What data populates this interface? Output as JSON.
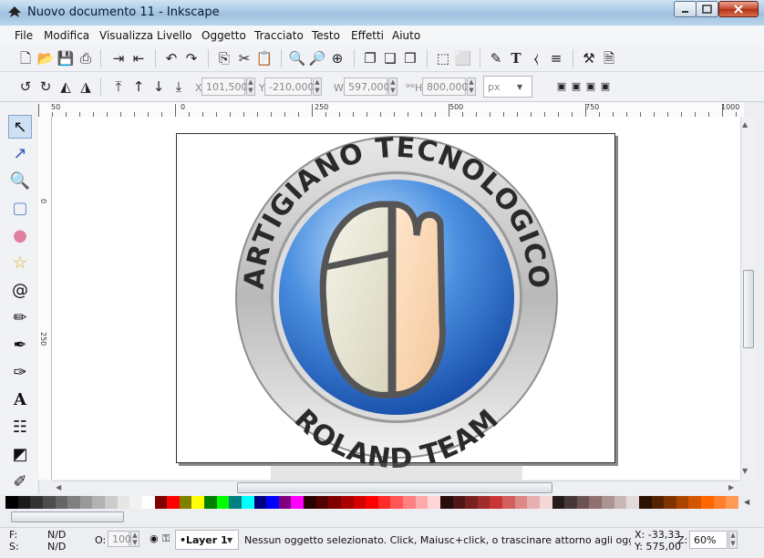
{
  "window": {
    "title": "Nuovo documento 11 - Inkscape",
    "icon": "inkscape-icon"
  },
  "menu": [
    "File",
    "Modifica",
    "Visualizza",
    "Livello",
    "Oggetto",
    "Tracciato",
    "Testo",
    "Effetti",
    "Aiuto"
  ],
  "toolbar2": {
    "x_label": "X",
    "x_value": "101,500",
    "y_label": "Y",
    "y_value": "-210,000",
    "w_label": "W",
    "w_value": "597,000",
    "h_label": "H",
    "h_value": "800,000",
    "unit": "px"
  },
  "ruler_top": [
    "50",
    "0",
    "250",
    "500",
    "750",
    "1000"
  ],
  "ruler_left": [
    "0",
    "250"
  ],
  "artwork": {
    "top_text": "ARTIGIANO TECNOLOGICO",
    "bottom_text": "ROLAND TEAM"
  },
  "status": {
    "fill_label": "F:",
    "fill_value": "N/D",
    "stroke_label": "S:",
    "stroke_value": "N/D",
    "opacity_label": "O:",
    "opacity_value": "100",
    "layer": "•Layer 1",
    "message": "Nessun oggetto selezionato. Click, Maiusc+click, o trascinare attorno agli oggett",
    "cursor_x": "X: -33,33",
    "cursor_y": "Y: 575,00",
    "zoom_label": "Z:",
    "zoom_value": "60%"
  },
  "palette_colors": [
    "#000000",
    "#1a1a1a",
    "#333333",
    "#4d4d4d",
    "#666666",
    "#808080",
    "#999999",
    "#b3b3b3",
    "#cccccc",
    "#e6e6e6",
    "#f2f2f2",
    "#ffffff",
    "#800000",
    "#ff0000",
    "#808000",
    "#ffff00",
    "#008000",
    "#00ff00",
    "#008080",
    "#00ffff",
    "#000080",
    "#0000ff",
    "#800080",
    "#ff00ff",
    "#2b0000",
    "#550000",
    "#800000",
    "#aa0000",
    "#d40000",
    "#ff0000",
    "#ff2a2a",
    "#ff5555",
    "#ff8080",
    "#ffaaaa",
    "#ffd5d5",
    "#280b0b",
    "#501616",
    "#782121",
    "#a02c2c",
    "#c83737",
    "#d35f5f",
    "#de8787",
    "#e9afaf",
    "#f4d7d7",
    "#241c1c",
    "#483737",
    "#6c5353",
    "#916f6f",
    "#ac9393",
    "#c8b7b7",
    "#e3dbdb",
    "#2b1100",
    "#552200",
    "#803300",
    "#aa4400",
    "#d45500",
    "#ff6600",
    "#ff7f2a",
    "#ff9955"
  ]
}
